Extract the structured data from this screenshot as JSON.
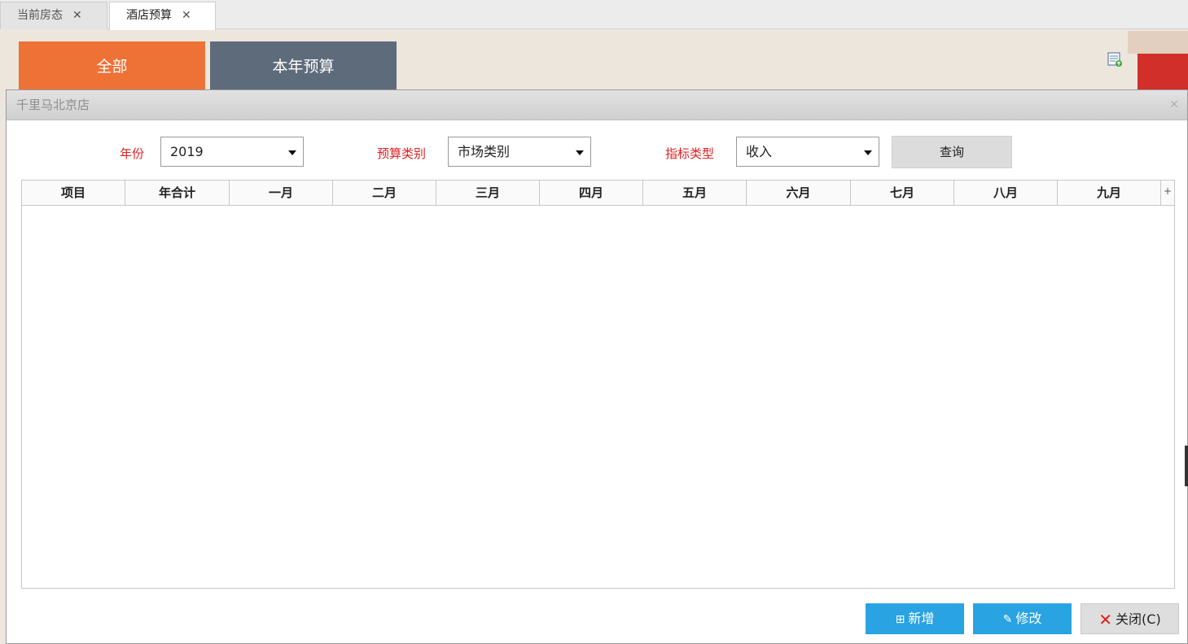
{
  "tabs": [
    {
      "label": "当前房态",
      "close": "✕"
    },
    {
      "label": "酒店预算",
      "close": "✕"
    }
  ],
  "tiles": {
    "all": "全部",
    "this_year": "本年预算"
  },
  "modal": {
    "title": "千里马北京店",
    "close": "✕"
  },
  "filters": {
    "year": {
      "label": "年份",
      "value": "2019"
    },
    "budget_type": {
      "label": "预算类别",
      "value": "市场类别"
    },
    "indicator_type": {
      "label": "指标类型",
      "value": "收入"
    },
    "query_label": "查询"
  },
  "grid": {
    "columns": [
      "项目",
      "年合计",
      "一月",
      "二月",
      "三月",
      "四月",
      "五月",
      "六月",
      "七月",
      "八月",
      "九月"
    ],
    "expand": "+",
    "rows": []
  },
  "actions": {
    "add": {
      "icon": "⊞",
      "label": "新增"
    },
    "edit": {
      "icon": "✎",
      "label": "修改"
    },
    "close": {
      "icon": "✕",
      "label": "关闭(C)"
    }
  },
  "colors": {
    "accent_orange": "#ee7136",
    "tile_slate": "#5e6b7b",
    "label_red": "#e02020",
    "button_blue": "#29a3e2"
  }
}
